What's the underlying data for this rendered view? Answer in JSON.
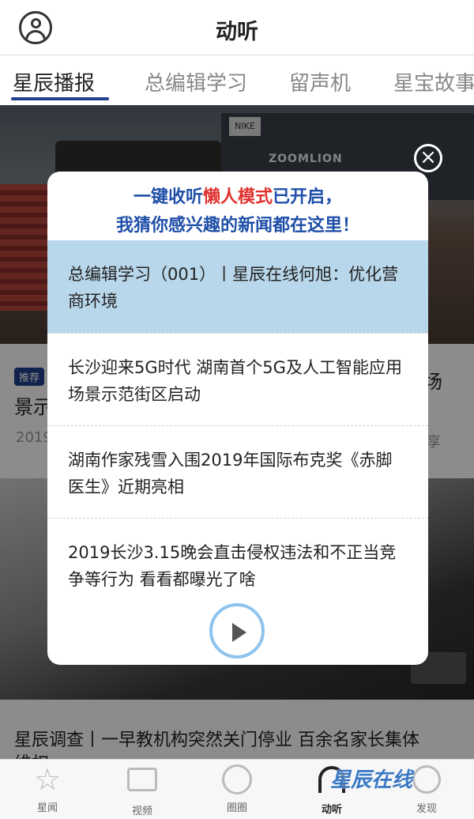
{
  "header": {
    "title": "动听"
  },
  "tabs": [
    {
      "label": "星辰播报",
      "active": true
    },
    {
      "label": "总编辑学习",
      "active": false
    },
    {
      "label": "留声机",
      "active": false
    },
    {
      "label": "星宝故事",
      "active": false
    }
  ],
  "background_feed": {
    "photo_text": {
      "brand1": "NIKE",
      "brand2": "ZOOMLION"
    },
    "news1": {
      "tag": "推荐",
      "title_left": "景示",
      "title_right": "用场",
      "date_fragment": "2019",
      "share_label": "享"
    },
    "news2": {
      "title_line1": "星辰调查丨一早教机构突然关门停业 百余名家长集体",
      "title_line2": "维权"
    }
  },
  "modal": {
    "header_line1_prefix": "一键收听",
    "header_line1_highlight": "懒人模式",
    "header_line1_suffix": "已开启，",
    "header_line2": "我猜你感兴趣的新闻都在这里！",
    "items": [
      {
        "text": "总编辑学习（001）丨星辰在线何旭：优化营商环境",
        "active": true
      },
      {
        "text": "长沙迎来5G时代 湖南首个5G及人工智能应用场景示范街区启动",
        "active": false
      },
      {
        "text": "湖南作家残雪入围2019年国际布克奖《赤脚医生》近期亮相",
        "active": false
      },
      {
        "text": "2019长沙3.15晚会直击侵权违法和不正当竞争等行为 看看都曝光了啥",
        "active": false
      }
    ],
    "close_symbol": "×"
  },
  "bottom_nav": [
    {
      "label": "星闻",
      "icon": "star-icon",
      "active": false
    },
    {
      "label": "视频",
      "icon": "video-icon",
      "active": false
    },
    {
      "label": "圈圈",
      "icon": "circle-icon",
      "active": false
    },
    {
      "label": "动听",
      "icon": "headphones-icon",
      "active": true
    },
    {
      "label": "发现",
      "icon": "discover-icon",
      "active": false
    }
  ],
  "watermark": "星辰在线",
  "colors": {
    "accent_blue": "#1f4fa8",
    "highlight_red": "#e0322f",
    "active_item_bg": "#b9d7ea",
    "tab_underline": "#1f3f8a"
  }
}
